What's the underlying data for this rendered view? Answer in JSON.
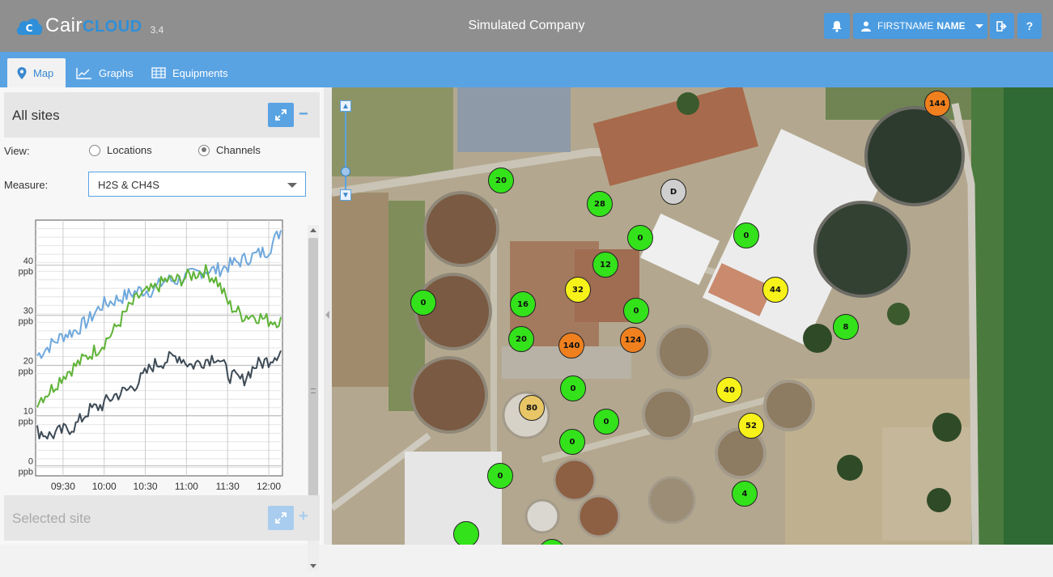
{
  "header": {
    "brand_cair": "Cair",
    "brand_cloud": "CLOUD",
    "version": "3.4",
    "company": "Simulated Company",
    "user_first": "FIRSTNAME",
    "user_last": "NAME",
    "help": "?"
  },
  "nav": {
    "tabs": [
      {
        "label": "Map",
        "icon": "map-pin-icon",
        "active": true
      },
      {
        "label": "Graphs",
        "icon": "line-chart-icon",
        "active": false
      },
      {
        "label": "Equipments",
        "icon": "grid-table-icon",
        "active": false
      }
    ]
  },
  "panel": {
    "title": "All sites",
    "view_label": "View:",
    "view_options": [
      "Locations",
      "Channels"
    ],
    "view_selected": "Channels",
    "measure_label": "Measure:",
    "measure_value": "H2S & CH4S",
    "selected_title": "Selected site"
  },
  "chart_data": {
    "type": "line",
    "x_ticks": [
      "09:30",
      "10:00",
      "10:30",
      "11:00",
      "11:30",
      "12:00"
    ],
    "y_ticks": [
      {
        "value": 0,
        "label": "0",
        "unit": "ppb"
      },
      {
        "value": 10,
        "label": "10",
        "unit": "ppb"
      },
      {
        "value": 20,
        "label": "20",
        "unit": "ppb"
      },
      {
        "value": 30,
        "label": "30",
        "unit": "ppb"
      },
      {
        "value": 40,
        "label": "40",
        "unit": "ppb"
      }
    ],
    "ylim": [
      -2,
      49
    ],
    "xlim": [
      "09:10",
      "12:10"
    ],
    "series": [
      {
        "color": "#6fa8dc",
        "values": [
          22,
          24,
          26,
          27,
          29,
          32,
          33,
          34,
          35,
          35,
          37,
          37,
          38,
          39,
          39,
          40,
          41,
          42,
          43,
          47
        ]
      },
      {
        "color": "#5fb337",
        "values": [
          13,
          15,
          18,
          20,
          22,
          24,
          27,
          31,
          34,
          35,
          37,
          37,
          38,
          39,
          37,
          32,
          30,
          30,
          29,
          29
        ]
      },
      {
        "color": "#3d4a55",
        "values": [
          7,
          6,
          7,
          8,
          11,
          12,
          14,
          15,
          17,
          20,
          21,
          22,
          20,
          21,
          22,
          18,
          17,
          20,
          21,
          23
        ]
      }
    ]
  },
  "map": {
    "markers": [
      {
        "value": "144",
        "color": "#f0801e"
      },
      {
        "value": "20",
        "color": "#33e21a"
      },
      {
        "value": "28",
        "color": "#33e21a"
      },
      {
        "value": "D",
        "color": "#cfcfcf"
      },
      {
        "value": "0",
        "color": "#33e21a"
      },
      {
        "value": "12",
        "color": "#33e21a"
      },
      {
        "value": "0",
        "color": "#33e21a"
      },
      {
        "value": "16",
        "color": "#33e21a"
      },
      {
        "value": "32",
        "color": "#f7f219"
      },
      {
        "value": "0",
        "color": "#33e21a"
      },
      {
        "value": "44",
        "color": "#f7f219"
      },
      {
        "value": "8",
        "color": "#33e21a"
      },
      {
        "value": "0",
        "color": "#33e21a"
      },
      {
        "value": "20",
        "color": "#33e21a"
      },
      {
        "value": "140",
        "color": "#f0801e"
      },
      {
        "value": "124",
        "color": "#f0801e"
      },
      {
        "value": "0",
        "color": "#33e21a"
      },
      {
        "value": "80",
        "color": "#e8c666"
      },
      {
        "value": "0",
        "color": "#33e21a"
      },
      {
        "value": "40",
        "color": "#f7f219"
      },
      {
        "value": "52",
        "color": "#f7f219"
      },
      {
        "value": "0",
        "color": "#33e21a"
      },
      {
        "value": "0",
        "color": "#33e21a"
      },
      {
        "value": "4",
        "color": "#33e21a"
      },
      {
        "value": "",
        "color": "#33e21a"
      },
      {
        "value": "",
        "color": "#33e21a"
      }
    ]
  }
}
